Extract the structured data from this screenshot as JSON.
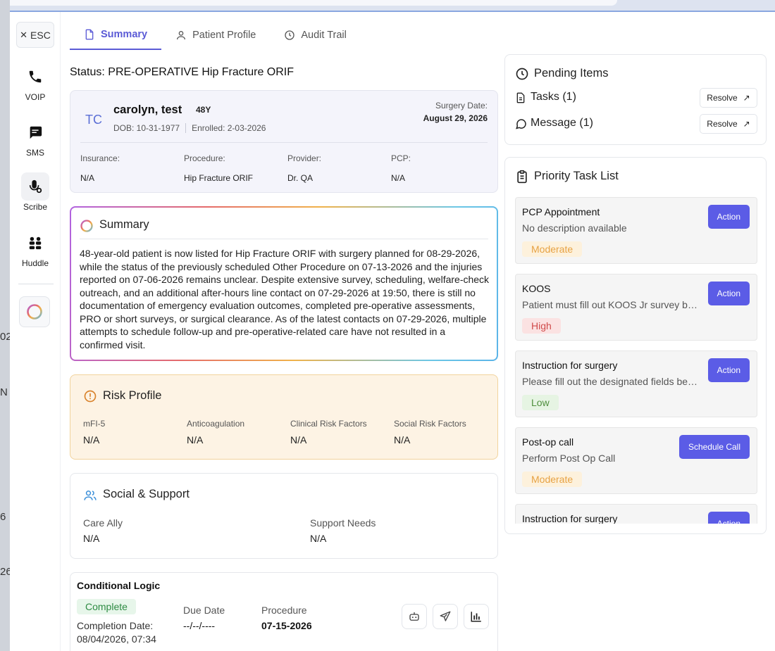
{
  "background": {
    "fragments": [
      "02",
      "N",
      "6",
      "26"
    ]
  },
  "rail": {
    "esc_label": "ESC",
    "items": [
      {
        "label": "VOIP",
        "icon": "phone-icon"
      },
      {
        "label": "SMS",
        "icon": "chat-icon"
      },
      {
        "label": "Scribe",
        "icon": "microphone-icon"
      },
      {
        "label": "Huddle",
        "icon": "huddle-icon"
      }
    ]
  },
  "tabs": [
    {
      "label": "Summary",
      "icon": "document-icon",
      "active": true
    },
    {
      "label": "Patient Profile",
      "icon": "user-icon",
      "active": false
    },
    {
      "label": "Audit Trail",
      "icon": "clock-icon",
      "active": false
    }
  ],
  "status": {
    "label": "Status:",
    "value": "PRE-OPERATIVE Hip Fracture ORIF"
  },
  "patient": {
    "initials": "TC",
    "name": "carolyn, test",
    "age": "48Y",
    "dob": "DOB: 10-31-1977",
    "enrolled": "Enrolled: 2-03-2026",
    "surgery_date_label": "Surgery Date:",
    "surgery_date": "August 29, 2026",
    "fields": [
      {
        "label": "Insurance:",
        "value": "N/A"
      },
      {
        "label": "Procedure:",
        "value": "Hip Fracture ORIF"
      },
      {
        "label": "Provider:",
        "value": "Dr. QA"
      },
      {
        "label": "PCP:",
        "value": "N/A"
      }
    ]
  },
  "summary": {
    "title": "Summary",
    "text": "48-year-old patient is now listed for Hip Fracture ORIF with surgery planned for 08-29-2026, while the status of the previously scheduled Other Procedure on 07-13-2026 and the injuries reported on 07-06-2026 remains unclear. Despite extensive survey, scheduling, welfare-check outreach, and an additional after-hours line contact on 07-29-2026 at 19:50, there is still no documentation of emergency evaluation outcomes, completed pre-operative assessments, PRO or short surveys, or surgical clearance. As of the latest contacts on 07-29-2026, multiple attempts to schedule follow-up and pre-operative-related care have not resulted in a confirmed visit."
  },
  "risk": {
    "title": "Risk Profile",
    "fields": [
      {
        "label": "mFI-5",
        "value": "N/A"
      },
      {
        "label": "Anticoagulation",
        "value": "N/A"
      },
      {
        "label": "Clinical Risk Factors",
        "value": "N/A"
      },
      {
        "label": "Social Risk Factors",
        "value": "N/A"
      }
    ]
  },
  "social": {
    "title": "Social & Support",
    "fields": [
      {
        "label": "Care Ally",
        "value": "N/A"
      },
      {
        "label": "Support Needs",
        "value": "N/A"
      }
    ]
  },
  "conditional": {
    "title": "Conditional Logic",
    "status": "Complete",
    "completion_label": "Completion Date:",
    "completion_value": "08/04/2026, 07:34",
    "due_label": "Due Date",
    "due_value": "--/--/----",
    "procedure_label": "Procedure",
    "procedure_value": "07-15-2026"
  },
  "pending": {
    "title": "Pending Items",
    "items": [
      {
        "label": "Tasks (1)",
        "action": "Resolve"
      },
      {
        "label": "Message (1)",
        "action": "Resolve"
      }
    ]
  },
  "priority": {
    "title": "Priority Task List",
    "tasks": [
      {
        "title": "PCP Appointment",
        "desc": "No description available",
        "priority": "Moderate",
        "level": "moderate",
        "action": "Action"
      },
      {
        "title": "KOOS",
        "desc": "Patient must fill out KOOS Jr survey before surgery",
        "priority": "High",
        "level": "high",
        "action": "Action"
      },
      {
        "title": "Instruction for surgery",
        "desc": "Please fill out the designated fields before surgery",
        "priority": "Low",
        "level": "low",
        "action": "Action"
      },
      {
        "title": "Post-op call",
        "desc": "Perform Post Op Call",
        "priority": "Moderate",
        "level": "moderate",
        "action": "Schedule Call"
      },
      {
        "title": "Instruction for surgery",
        "desc": "",
        "priority": "",
        "level": "low",
        "action": "Action"
      }
    ]
  },
  "colors": {
    "accent": "#5b5ce6",
    "tab_active": "#5b5bd6"
  }
}
